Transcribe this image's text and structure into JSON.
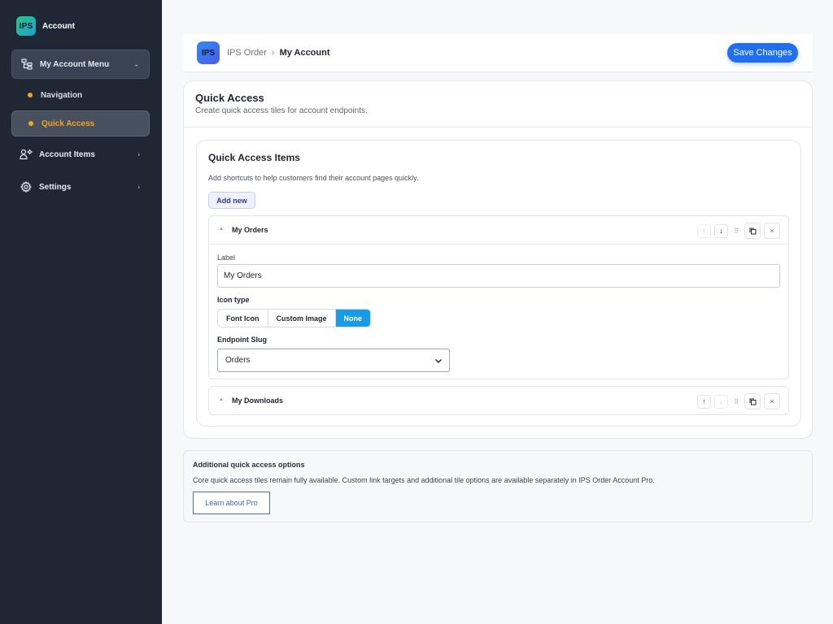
{
  "sidebar": {
    "brand": {
      "logo_text": "IPS",
      "title": "Account"
    },
    "items": [
      {
        "label": "My Account Menu",
        "icon": "sitemap-icon",
        "expanded": true
      },
      {
        "label": "Navigation"
      },
      {
        "label": "Quick Access",
        "active": true
      },
      {
        "label": "Account Items",
        "icon": "user-gear-icon"
      },
      {
        "label": "Settings",
        "icon": "gear-icon"
      }
    ]
  },
  "header": {
    "logo_text": "IPS",
    "breadcrumb": [
      "IPS Order",
      "My Account"
    ],
    "separator": "›",
    "save_label": "Save Changes"
  },
  "page": {
    "title": "Quick Access",
    "subtitle": "Create quick access tiles for account endpoints.",
    "section": {
      "title": "Quick Access Items",
      "description": "Add shortcuts to help customers find their account pages quickly.",
      "add_label": "Add new",
      "items": [
        {
          "title": "My Orders",
          "expanded": true,
          "label_caption": "Label",
          "label_value": "My Orders",
          "icon_type_caption": "Icon type",
          "icon_type_options": [
            "Font Icon",
            "Custom Image",
            "None"
          ],
          "icon_type_selected": "None",
          "endpoint_caption": "Endpoint Slug",
          "endpoint_value": "Orders"
        },
        {
          "title": "My Downloads",
          "expanded": false
        }
      ]
    }
  },
  "pro": {
    "title": "Additional quick access options",
    "description": "Core quick access tiles remain fully available. Custom link targets and additional tile options are available separately in IPS Order Account Pro.",
    "button_label": "Learn about Pro"
  },
  "colors": {
    "sidebar_bg": "#1f2735",
    "accent_orange": "#f5a524",
    "primary_blue": "#1f6ff0",
    "segment_active": "#1a9be6",
    "delete_red": "#d63a3a"
  }
}
